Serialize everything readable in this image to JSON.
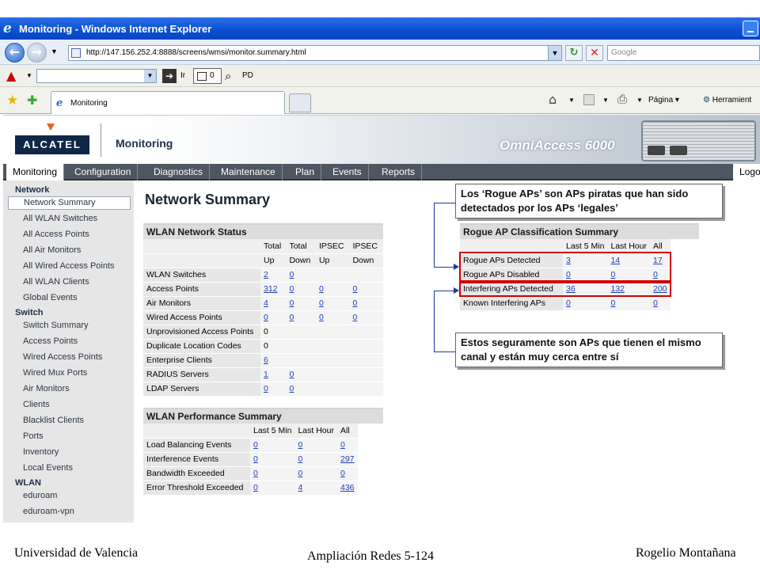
{
  "browser": {
    "window_title": "Monitoring - Windows Internet Explorer",
    "url": "http://147.156.252.4:8888/screens/wmsi/monitor.summary.html",
    "search_placeholder": "Google",
    "go_label": "Ir",
    "tabs_count": "0",
    "pd_label": "PD",
    "tab_title": "Monitoring",
    "page_menu": "Página",
    "tools_menu": "Herramient"
  },
  "app": {
    "logo": "ALCATEL",
    "title": "Monitoring",
    "product": "OmniAccess 6000",
    "menu": [
      "Monitoring",
      "Configuration",
      "Diagnostics",
      "Maintenance",
      "Plan",
      "Events",
      "Reports",
      "Logo"
    ]
  },
  "sidebar": {
    "sections": [
      {
        "heading": "Network",
        "items": [
          "Network Summary",
          "All WLAN Switches",
          "All Access Points",
          "All Air Monitors",
          "All Wired Access Points",
          "All WLAN Clients",
          "Global Events"
        ]
      },
      {
        "heading": "Switch",
        "items": [
          "Switch Summary",
          "Access Points",
          "Wired Access Points",
          "Wired Mux Ports",
          "Air Monitors",
          "Clients",
          "Blacklist Clients",
          "Ports",
          "Inventory",
          "Local Events"
        ]
      },
      {
        "heading": "WLAN",
        "items": [
          "eduroam",
          "eduroam-vpn"
        ]
      }
    ],
    "selected": "Network Summary"
  },
  "page": {
    "title": "Network Summary",
    "wlan_status": {
      "title": "WLAN Network Status",
      "header1": [
        "",
        "Total",
        "Total",
        "IPSEC",
        "IPSEC"
      ],
      "header2": [
        "",
        "Up",
        "Down",
        "Up",
        "Down"
      ],
      "rows": [
        {
          "label": "WLAN Switches",
          "values": [
            "2",
            "0",
            "",
            ""
          ]
        },
        {
          "label": "Access Points",
          "values": [
            "312",
            "0",
            "0",
            "0"
          ]
        },
        {
          "label": "Air Monitors",
          "values": [
            "4",
            "0",
            "0",
            "0"
          ]
        },
        {
          "label": "Wired Access Points",
          "values": [
            "0",
            "0",
            "0",
            "0"
          ]
        },
        {
          "label": "Unprovisioned Access Points",
          "values": [
            "0",
            "",
            "",
            ""
          ]
        },
        {
          "label": "Duplicate Location Codes",
          "values": [
            "0",
            "",
            "",
            ""
          ]
        },
        {
          "label": "Enterprise Clients",
          "values": [
            "6",
            "",
            "",
            ""
          ]
        },
        {
          "label": "RADIUS Servers",
          "values": [
            "1",
            "0",
            "",
            ""
          ]
        },
        {
          "label": "LDAP Servers",
          "values": [
            "0",
            "0",
            "",
            ""
          ]
        }
      ]
    },
    "wlan_perf": {
      "title": "WLAN Performance Summary",
      "header": [
        "",
        "Last 5 Min",
        "Last Hour",
        "All"
      ],
      "rows": [
        {
          "label": "Load Balancing Events",
          "values": [
            "0",
            "0",
            "0"
          ]
        },
        {
          "label": "Interference Events",
          "values": [
            "0",
            "0",
            "297"
          ]
        },
        {
          "label": "Bandwidth Exceeded",
          "values": [
            "0",
            "0",
            "0"
          ]
        },
        {
          "label": "Error Threshold Exceeded",
          "values": [
            "0",
            "4",
            "436"
          ]
        }
      ]
    },
    "rogue": {
      "title": "Rogue AP Classification Summary",
      "header": [
        "",
        "Last 5 Min",
        "Last Hour",
        "All"
      ],
      "rows": [
        {
          "label": "Rogue APs Detected",
          "values": [
            "3",
            "14",
            "17"
          ]
        },
        {
          "label": "Rogue APs Disabled",
          "values": [
            "0",
            "0",
            "0"
          ]
        },
        {
          "label": "Interfering APs Detected",
          "values": [
            "36",
            "132",
            "200"
          ]
        },
        {
          "label": "Known Interfering APs",
          "values": [
            "0",
            "0",
            "0"
          ]
        }
      ]
    }
  },
  "annotations": {
    "callout1": "Los ‘Rogue APs’ son APs piratas que han sido detectados por los APs ‘legales’",
    "callout2": "Estos seguramente son APs que tienen el mismo canal y están muy cerca entre sí",
    "highlight_color": "#d00000",
    "arrow_color": "#1a3a9a"
  },
  "footer": {
    "left": "Universidad de Valencia",
    "center": "Ampliación Redes 5-124",
    "right": "Rogelio Montañana"
  }
}
